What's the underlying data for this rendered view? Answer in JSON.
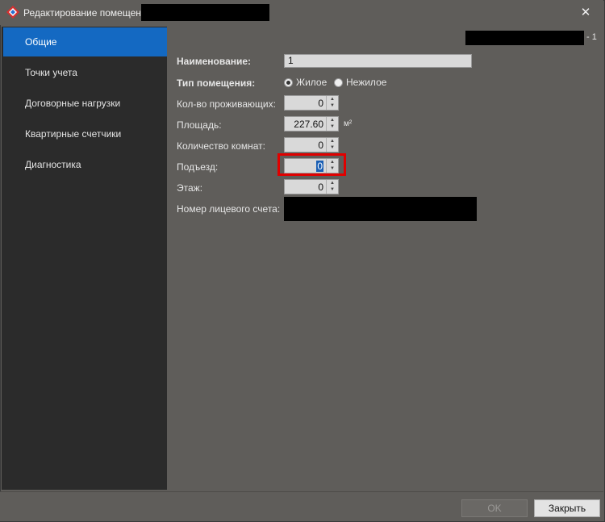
{
  "window": {
    "title": "Редактирование помещения",
    "close_symbol": "✕"
  },
  "sidebar": {
    "items": [
      {
        "label": "Общие",
        "active": true
      },
      {
        "label": "Точки учета",
        "active": false
      },
      {
        "label": "Договорные нагрузки",
        "active": false
      },
      {
        "label": "Квартирные счетчики",
        "active": false
      },
      {
        "label": "Диагностика",
        "active": false
      }
    ]
  },
  "header": {
    "suffix": "- 1"
  },
  "form": {
    "name_label": "Наименование:",
    "name_value": "1",
    "type_label": "Тип помещения:",
    "type_options": [
      "Жилое",
      "Нежилое"
    ],
    "type_selected": "Жилое",
    "residents_label": "Кол-во проживающих:",
    "residents_value": "0",
    "area_label": "Площадь:",
    "area_value": "227.60",
    "area_unit": "м²",
    "rooms_label": "Количество комнат:",
    "rooms_value": "0",
    "entrance_label": "Подъезд:",
    "entrance_value": "0",
    "floor_label": "Этаж:",
    "floor_value": "0",
    "account_label": "Номер лицевого счета:"
  },
  "footer": {
    "ok_label": "OK",
    "close_label": "Закрыть"
  },
  "colors": {
    "accent": "#1469c2",
    "highlight": "#e00000"
  }
}
